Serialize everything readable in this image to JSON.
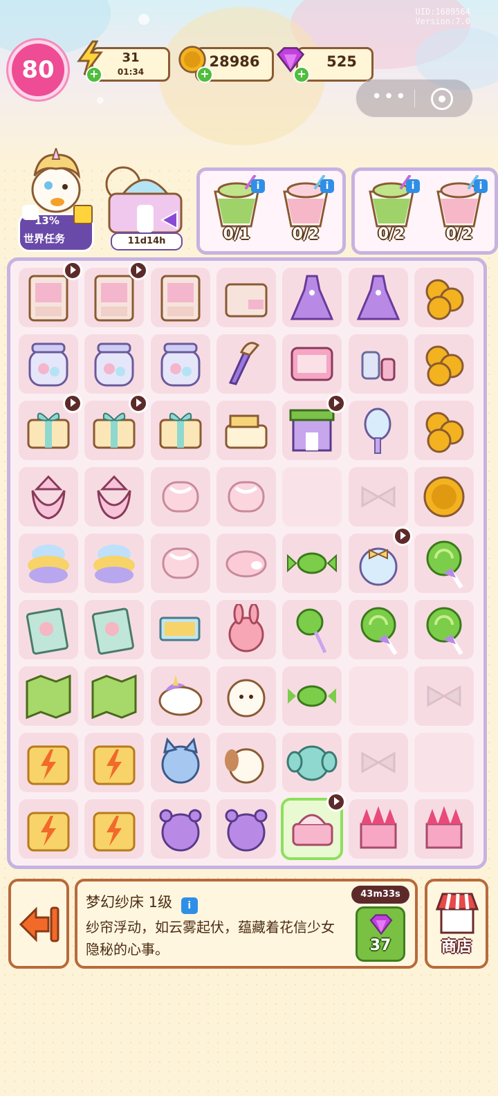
{
  "watermark": [
    "UID:1689564",
    "Version:7.0"
  ],
  "hud": {
    "level": "80",
    "energy": {
      "value": "31",
      "timer": "01:34"
    },
    "coins": {
      "value": "28986"
    },
    "gems": {
      "value": "525"
    }
  },
  "world_task": {
    "percent": "13%",
    "label": "世界任务"
  },
  "event": {
    "timer": "11d14h"
  },
  "orders": [
    {
      "items": [
        {
          "icon": "matcha-drink-icon",
          "count": "0/1"
        },
        {
          "icon": "strawberry-drink-icon",
          "count": "0/2"
        }
      ]
    },
    {
      "items": [
        {
          "icon": "matcha-drink-icon",
          "count": "0/2"
        },
        {
          "icon": "strawberry-drink-icon",
          "count": "0/2"
        }
      ]
    }
  ],
  "board": [
    [
      "cabinet",
      "cabinet",
      "cabinet",
      "dresser",
      "purple-dress",
      "purple-dress",
      "gold-coins"
    ],
    [
      "candy-jar",
      "candy-jar",
      "candy-jar",
      "makeup-brushes",
      "eyeshadow-palette",
      "cosmetics-set",
      "gold-coins"
    ],
    [
      "gift-box",
      "gift-box",
      "gift-box",
      "gift-box-open",
      "shop-building",
      "hand-mirror",
      "gold-coins"
    ],
    [
      "candy-bag",
      "candy-bag",
      "marshmallow",
      "marshmallow",
      "",
      "bow-slot",
      "gold-coin"
    ],
    [
      "cotton-candy",
      "cotton-candy",
      "marshmallow",
      "roll-cake",
      "green-candy",
      "candy-jar-bow",
      "green-lollipop"
    ],
    [
      "storybook",
      "storybook",
      "tickets",
      "bunny-plush",
      "green-lollipop-small",
      "green-lollipop",
      "green-lollipop"
    ],
    [
      "map",
      "map",
      "unicorn-plush",
      "sheep-plush",
      "green-candy-slot",
      "",
      "bow-slot"
    ],
    [
      "gate-locked",
      "gate-locked",
      "cat-plush",
      "puppy-plush",
      "elephant-plush",
      "bow-slot",
      ""
    ],
    [
      "gate-locked",
      "gate-locked",
      "bear-plush",
      "bear-plush",
      "dream-bed",
      "castle",
      "castle"
    ]
  ],
  "timers_on": [
    [
      0,
      0
    ],
    [
      0,
      1
    ],
    [
      2,
      0
    ],
    [
      2,
      1
    ],
    [
      2,
      4
    ],
    [
      4,
      5
    ],
    [
      8,
      4
    ]
  ],
  "colors": {
    "accent": "#ee4c94",
    "board_border": "#c7b2e2",
    "panel_border": "#b86a3a"
  },
  "selected": {
    "title": "梦幻纱床 1级",
    "description": "纱帘浮动，如云雾起伏，蕴藏着花信少女隐秘的心事。",
    "timer": "43m33s",
    "speedup_cost": "37"
  },
  "shop": {
    "label": "商店"
  }
}
